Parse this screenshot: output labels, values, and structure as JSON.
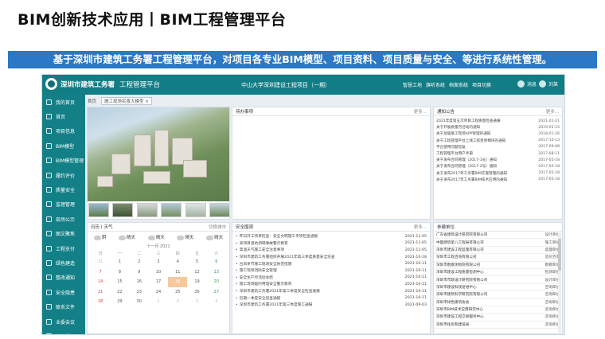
{
  "slide_title": "BIM创新技术应用丨BIM工程管理平台",
  "banner": "基于深圳市建筑工务署工程管理平台，对项目各专业BIM模型、项目资料、项目质量与安全、等进行系统性管理。",
  "header": {
    "logo_text": "深圳市建筑工务署",
    "app_title": "工程管理平台",
    "project_name": "中山大学深圳建设工程项目（一期）",
    "nav": [
      "智慧工地",
      "旗听系统",
      "档案系统",
      "项目切换"
    ],
    "bell_label": "消息",
    "user_name": "刘某"
  },
  "sidebar": {
    "items": [
      "我的首页",
      "首页",
      "项目信息",
      "BIM模型",
      "BIM模型管理",
      "履约评价",
      "质量安全",
      "监理管理",
      "现场公示",
      "图文聚焦",
      "工程支付",
      "绿色建造",
      "整改通知",
      "安全隐患",
      "联系文件",
      "业委会议",
      "材料设备"
    ]
  },
  "breadcrumb": {
    "home": "首页",
    "tab": "施工现场实景大模型 ×"
  },
  "todo": {
    "title": "待办事项",
    "more": "更多..."
  },
  "notice": {
    "title": "通知公告",
    "more": "更多...",
    "rows": [
      {
        "t": "2021年度第五次项目工程质量检查通报",
        "d": "2021-01-21"
      },
      {
        "t": "关于开展质量月活动的通知",
        "d": "2019-05-15"
      },
      {
        "t": "关于加强施工现场APP管理的通知",
        "d": "2018-01-26"
      },
      {
        "t": "关于工程管理平台上线工程变更模块的通知",
        "d": "2017-10-13"
      },
      {
        "t": "平台使用问题答复",
        "d": "2017-09-08"
      },
      {
        "t": "工程管理平台用户手册",
        "d": "2017-08-11"
      },
      {
        "t": "关于发布合同管理（2017-1号）通知",
        "d": "2017-05-18"
      },
      {
        "t": "关于发布合同管理（2017-2号）通知",
        "d": "2017-05-18"
      },
      {
        "t": "关于发布2017年工务署BIM实施管理的通知",
        "d": "2017-05-18"
      },
      {
        "t": "关于发布2017年工务署BIM技术应用的通知",
        "d": "2017-05-18"
      }
    ]
  },
  "calendar": {
    "title": "日历丨天气",
    "more": "切换城市",
    "weather": [
      "阴",
      "晴天",
      "晴天",
      "晴天",
      "晴天"
    ],
    "month": "十一月 2021",
    "weekdays": [
      "日",
      "一",
      "二",
      "三",
      "四",
      "五",
      "六"
    ],
    "days": [
      "31",
      "1",
      "2",
      "3",
      "4",
      "5",
      "6",
      "7",
      "8",
      "9",
      "10",
      "11",
      "12",
      "13",
      "14",
      "15",
      "16",
      "17",
      "18",
      "19",
      "20",
      "21",
      "22",
      "23",
      "24",
      "25",
      "26",
      "27",
      "28",
      "29",
      "30",
      "1",
      "2",
      "3",
      "4"
    ]
  },
  "safety": {
    "title": "安全围观",
    "more": "更多...",
    "rows": [
      {
        "t": "昨日开工项目检查：安全文明施工专项检查通报",
        "d": "2021-11-05"
      },
      {
        "t": "某项目基坑坍塌事故警示教育",
        "d": "2021-11-05"
      },
      {
        "t": "高温天气施工安全注意事项",
        "d": "2021-11-05"
      },
      {
        "t": "深圳市建筑工务署组织开展2021年第三季度质量安全巡查",
        "d": "2021-10-18"
      },
      {
        "t": "台风季节施工现场安全防范措施",
        "d": "2021-10-11"
      },
      {
        "t": "施工现场消防安全管理",
        "d": "2021-10-11"
      },
      {
        "t": "安全生产月活动总结",
        "d": "2021-10-11"
      },
      {
        "t": "施工现场临时用电安全警示教育",
        "d": "2021-10-11"
      },
      {
        "t": "深圳市建筑工务署2021年第三季度安全检查通报",
        "d": "2021-10-11"
      },
      {
        "t": "近期一季度安全巡查通报",
        "d": "2021-10-11"
      },
      {
        "t": "深圳市建筑工务署2021年第三季度施工通报",
        "d": "2021-09-03"
      }
    ]
  },
  "units": {
    "title": "参建单位",
    "rows": [
      {
        "t": "广东省建筑设计研究院有限公司",
        "s": "设计单位"
      },
      {
        "t": "中国建筑第八工程局有限公司",
        "s": "施工单位"
      },
      {
        "t": "深圳市建设工程监理有限公司",
        "s": "监理单位"
      },
      {
        "t": "深圳市工程咨询有限公司",
        "s": "造价咨询"
      },
      {
        "t": "深圳市勘察测绘院有限公司",
        "s": "勘察单位"
      },
      {
        "t": "深圳市建设工程质量检测中心",
        "s": "检测单位"
      },
      {
        "t": "深圳市市政设计研究院有限公司",
        "s": "设计单位"
      },
      {
        "t": "深圳市建设科技促进中心",
        "s": "咨询单位"
      },
      {
        "t": "深圳市建筑科学研究院有限公司",
        "s": "咨询单位"
      },
      {
        "t": "深圳市绿色建筑协会",
        "s": "咨询单位"
      },
      {
        "t": "深圳市BIM技术应用研究中心",
        "s": "咨询单位"
      },
      {
        "t": "深圳市建设工程交易服务中心",
        "s": "咨询单位"
      },
      {
        "t": "深圳市住房和建设局",
        "s": "咨询单位"
      }
    ]
  },
  "colors": {
    "header": "#117d84",
    "banner": "#2a78c6",
    "today": "#f6c89b"
  }
}
